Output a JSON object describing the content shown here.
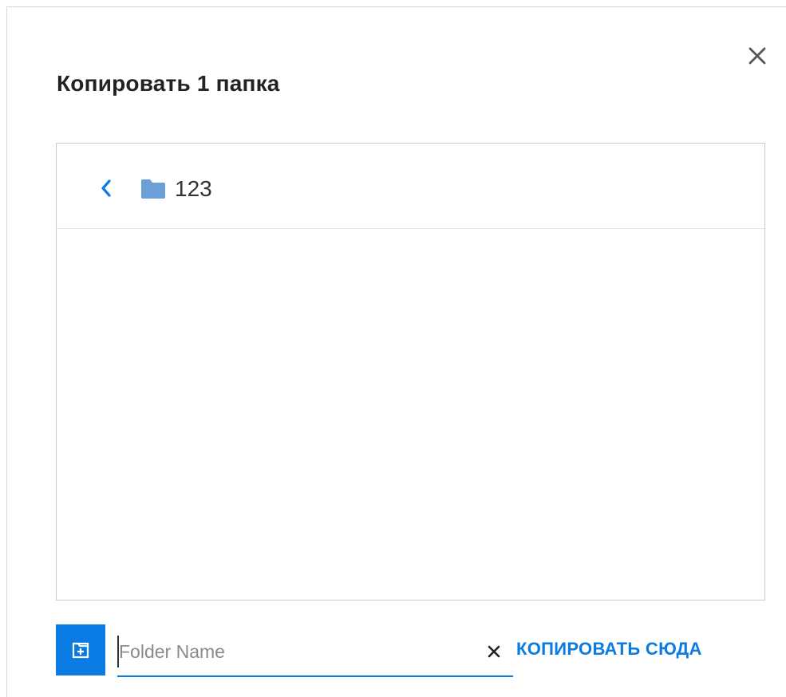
{
  "dialog": {
    "title": "Копировать 1 папка",
    "close_icon": "close-icon"
  },
  "browser": {
    "back_icon": "chevron-left-icon",
    "folder_icon": "folder-icon",
    "current_folder": "123"
  },
  "footer": {
    "add_folder_icon": "new-folder-icon",
    "folder_name_value": "",
    "folder_name_placeholder": "Folder Name",
    "clear_icon": "clear-icon",
    "copy_here_label": "КОПИРОВАТЬ СЮДА"
  },
  "colors": {
    "accent": "#0a7be3",
    "folder": "#6a9fd8",
    "text": "#222222",
    "border": "#c9c9c9"
  }
}
